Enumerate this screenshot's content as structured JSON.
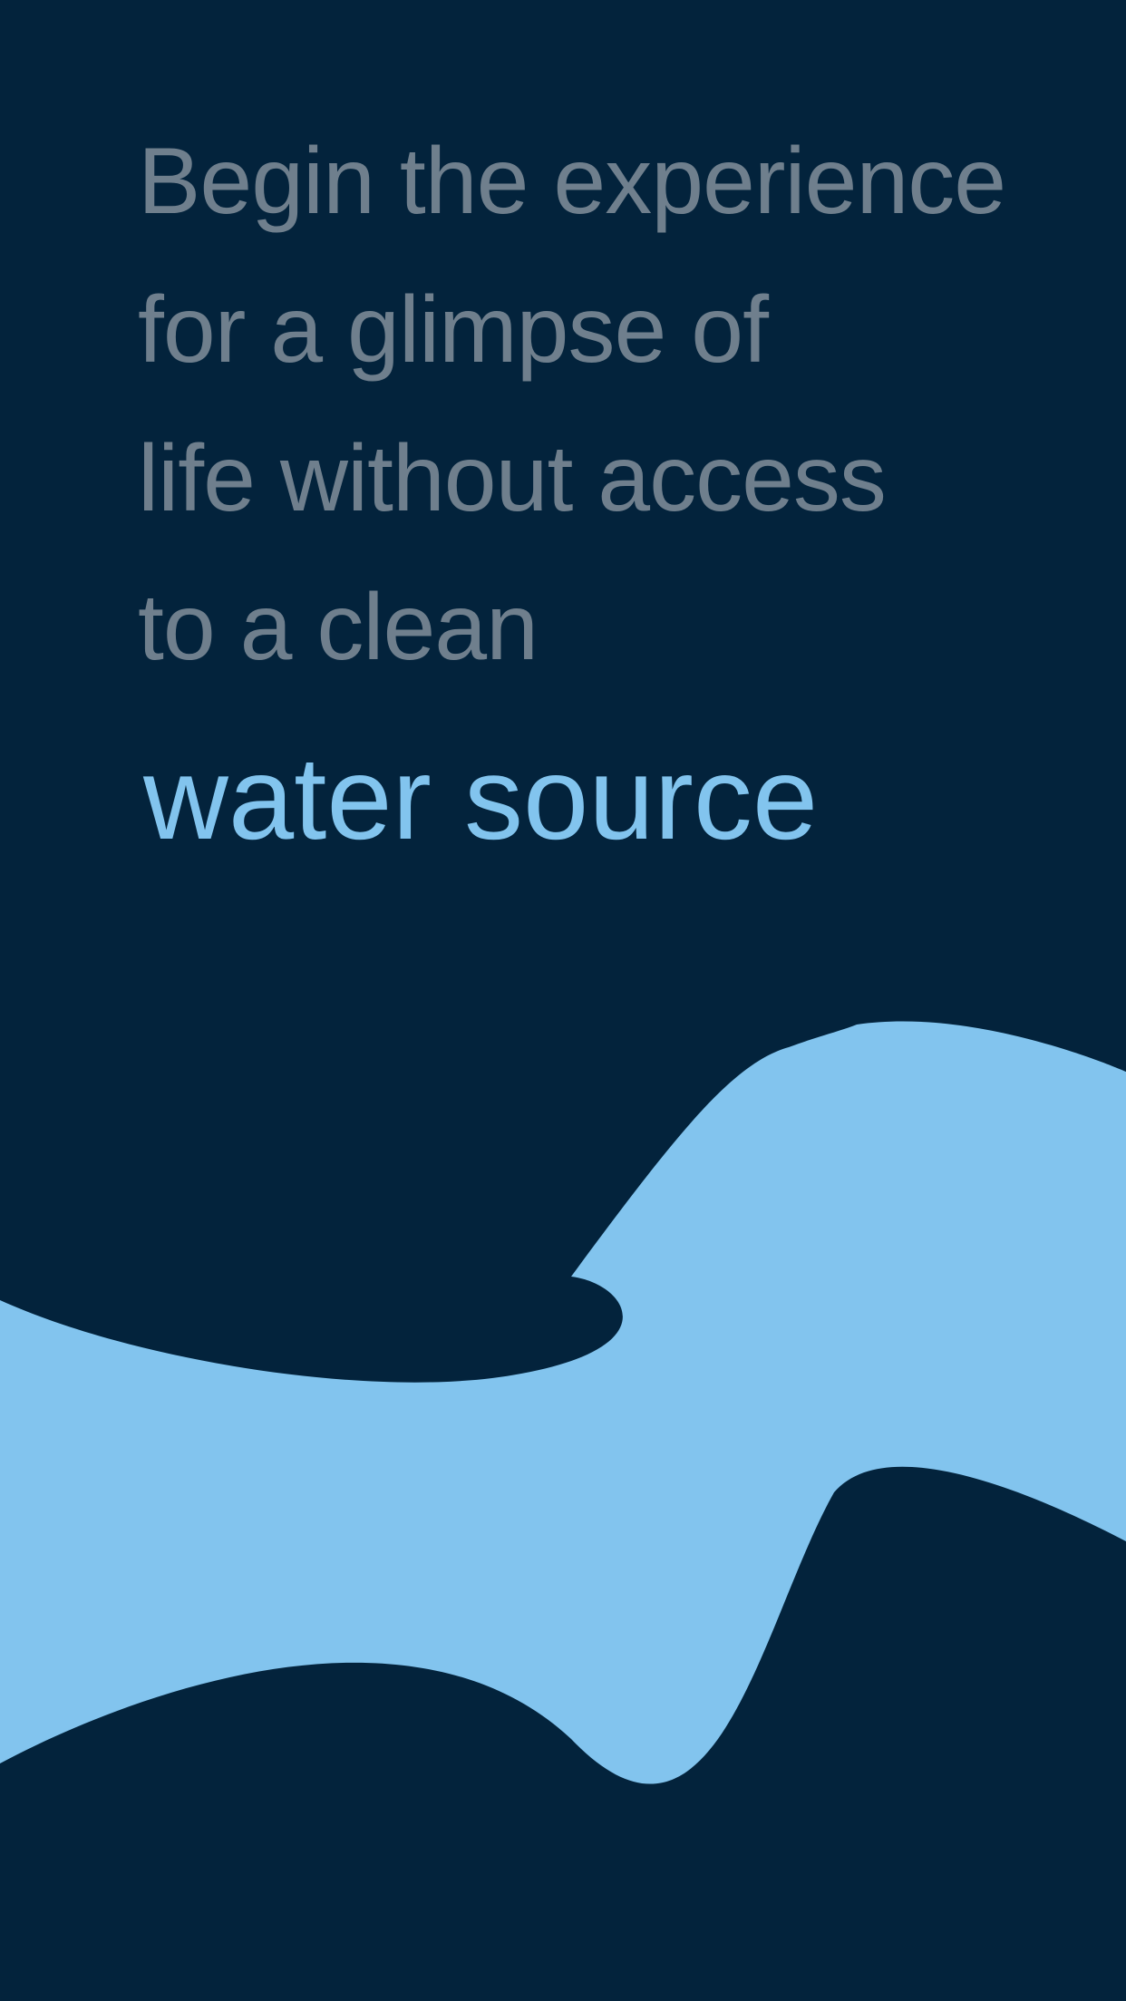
{
  "intro": {
    "lines": [
      "Begin the experience",
      "for a glimpse of",
      "life without access",
      "to a clean"
    ]
  },
  "headline": "water source",
  "colors": {
    "background": "#03233c",
    "intro_text": "#6f7f8d",
    "accent": "#82c4ee"
  },
  "graphics": {
    "wave": "water-wave-illustration"
  }
}
